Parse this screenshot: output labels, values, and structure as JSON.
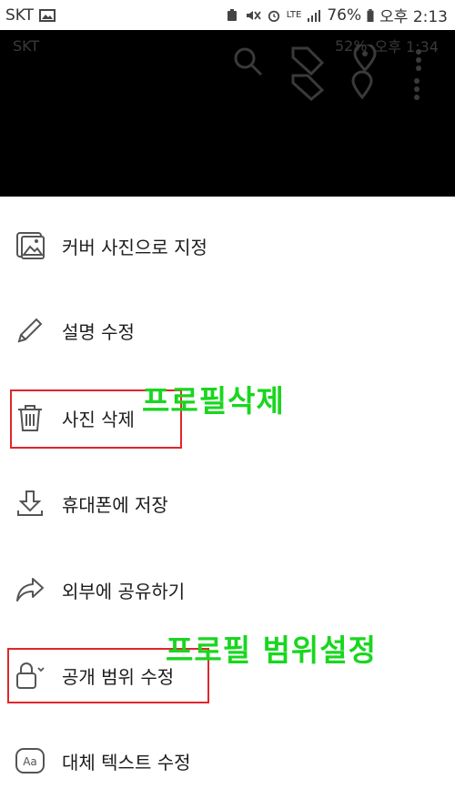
{
  "status_bar": {
    "carrier": "SKT",
    "lte": "LTE",
    "battery": "76%",
    "time": "오후 2:13"
  },
  "viewer": {
    "ghost_status": {
      "carrier": "SKT",
      "battery": "52%",
      "time": "오후 1:34"
    }
  },
  "menu": {
    "items": [
      {
        "label": "커버 사진으로 지정",
        "icon": "image-frame-icon"
      },
      {
        "label": "설명 수정",
        "icon": "pencil-icon"
      },
      {
        "label": "사진 삭제",
        "icon": "trash-icon"
      },
      {
        "label": "휴대폰에 저장",
        "icon": "download-icon"
      },
      {
        "label": "외부에 공유하기",
        "icon": "share-icon"
      },
      {
        "label": "공개 범위 수정",
        "icon": "lock-icon"
      },
      {
        "label": "대체 텍스트 수정",
        "icon": "alt-text-icon"
      }
    ]
  },
  "annotations": {
    "delete_note": "프로필삭제",
    "privacy_note": "프로필 범위설정",
    "highlight_color": "#e0262b",
    "text_color": "#19d61f"
  }
}
